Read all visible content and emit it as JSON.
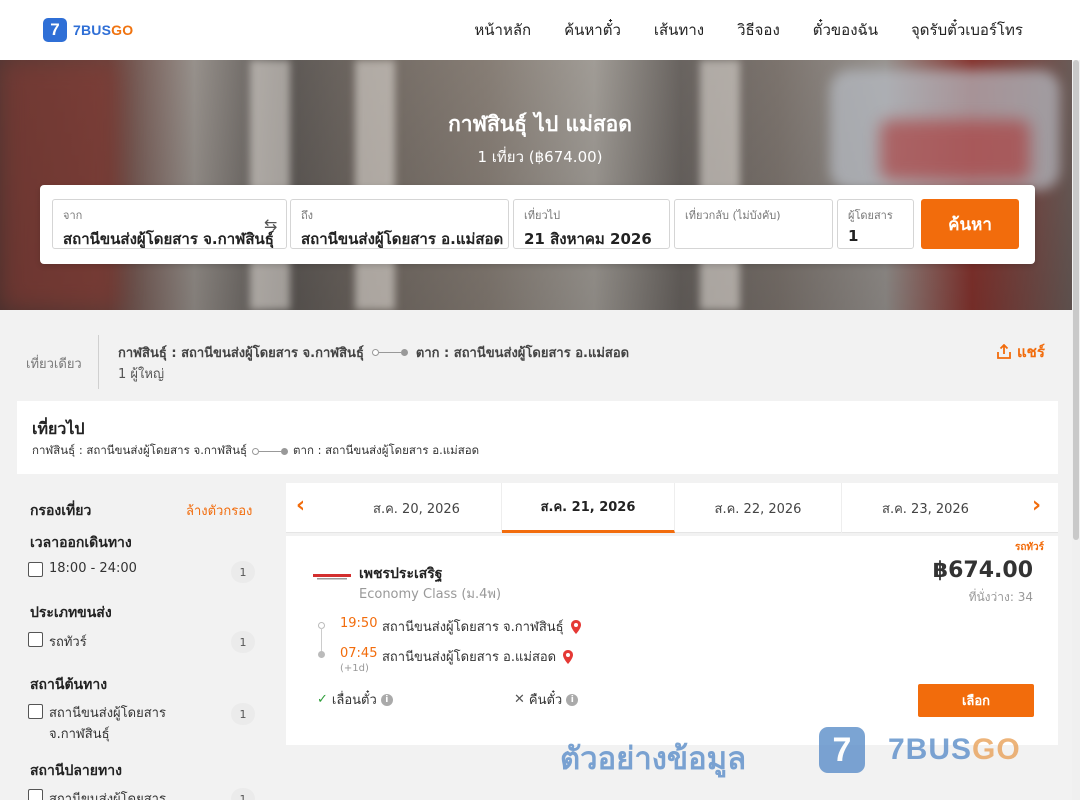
{
  "nav": {
    "logo_mark": "7",
    "logo_text_a": "7BUS",
    "logo_text_b": "GO",
    "items": [
      "หน้าหลัก",
      "ค้นหาตั๋ว",
      "เส้นทาง",
      "วิธีจอง",
      "ตั๋วของฉัน",
      "จุดรับตั๋วเบอร์โทร"
    ]
  },
  "hero": {
    "title": "กาฬสินธุ์ ไป แม่สอด",
    "subtitle": "1 เที่ยว (฿674.00)"
  },
  "search": {
    "from_label": "จาก",
    "from_value": "สถานีขนส่งผู้โดยสาร จ.กาฬสินธุ์",
    "to_label": "ถึง",
    "to_value": "สถานีขนส่งผู้โดยสาร อ.แม่สอด",
    "depart_label": "เที่ยวไป",
    "depart_value": "21 สิงหาคม 2026",
    "return_label": "เที่ยวกลับ (ไม่บังคับ)",
    "return_value": "",
    "pax_label": "ผู้โดยสาร",
    "pax_value": "1",
    "button": "ค้นหา"
  },
  "summary": {
    "trip_type": "เที่ยวเดียว",
    "from": "กาฬสินธุ์ : สถานีขนส่งผู้โดยสาร จ.กาฬสินธุ์",
    "to": "ตาก : สถานีขนส่งผู้โดยสาร อ.แม่สอด",
    "passengers": "1 ผู้ใหญ่",
    "share": "แชร์"
  },
  "outbound": {
    "title": "เที่ยวไป",
    "from": "กาฬสินธุ์ : สถานีขนส่งผู้โดยสาร จ.กาฬสินธุ์",
    "to": "ตาก : สถานีขนส่งผู้โดยสาร อ.แม่สอด"
  },
  "filters": {
    "title": "กรองเที่ยว",
    "clear": "ล้างตัวกรอง",
    "departure_time": {
      "label": "เวลาออกเดินทาง",
      "option": "18:00 - 24:00",
      "count": "1"
    },
    "transport_type": {
      "label": "ประเภทขนส่ง",
      "option": "รถทัวร์",
      "count": "1"
    },
    "origin_station": {
      "label": "สถานีต้นทาง",
      "option_line1": "สถานีขนส่งผู้โดยสาร",
      "option_line2": "จ.กาฬสินธุ์",
      "count": "1"
    },
    "dest_station": {
      "label": "สถานีปลายทาง",
      "option_line1": "สถานีขนส่งผู้โดยสาร",
      "count": "1"
    }
  },
  "dates": {
    "prev": "‹",
    "next": "›",
    "tabs": [
      "ส.ค. 20, 2026",
      "ส.ค. 21, 2026",
      "ส.ค. 22, 2026",
      "ส.ค. 23, 2026"
    ],
    "active_index": 1
  },
  "result": {
    "bus_type": "รถทัวร์",
    "operator": "เพชรประเสริฐ",
    "bus_class": "Economy Class (ม.4พ)",
    "price": "฿674.00",
    "seats": "ที่นั่งว่าง: 34",
    "depart_time": "19:50",
    "depart_station": "สถานีขนส่งผู้โดยสาร จ.กาฬสินธุ์",
    "arrive_time": "07:45",
    "arrive_station": "สถานีขนส่งผู้โดยสาร อ.แม่สอด",
    "next_day": "(+1d)",
    "policy_change": "เลื่อนตั๋ว",
    "policy_refund": "คืนตั๋ว",
    "select": "เลือก"
  },
  "watermark": {
    "text": "ตัวอย่างข้อมูล",
    "logo_mark": "7",
    "brand_a": "7BUS",
    "brand_b": "GO"
  },
  "colors": {
    "accent": "#f26c0c",
    "brand_blue": "#2f6fd6"
  }
}
